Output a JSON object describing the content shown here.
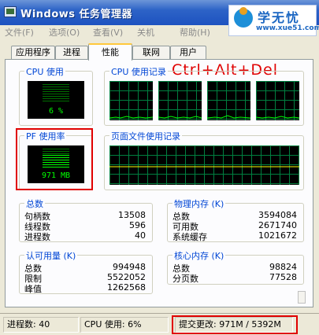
{
  "window": {
    "title": "Windows 任务管理器"
  },
  "brand": {
    "name": "学无忧",
    "url": "www.xue51.com"
  },
  "menu": {
    "items": [
      "文件(F)",
      "选项(O)",
      "查看(V)",
      "关机",
      "帮助(H)"
    ]
  },
  "tabs": [
    "应用程序",
    "进程",
    "性能",
    "联网",
    "用户"
  ],
  "active_tab": "性能",
  "overlay_hint": "Ctrl+Alt+Del",
  "cpu_usage": {
    "label": "CPU 使用",
    "value": "6 %",
    "fraction": 0.06
  },
  "cpu_history": {
    "label": "CPU 使用记录",
    "graph_count": 4
  },
  "pf_usage": {
    "label": "PF 使用率",
    "value": "971 MB"
  },
  "pf_history": {
    "label": "页面文件使用记录"
  },
  "totals": {
    "label": "总数",
    "rows": [
      {
        "label": "句柄数",
        "value": "13508"
      },
      {
        "label": "线程数",
        "value": "596"
      },
      {
        "label": "进程数",
        "value": "40"
      }
    ]
  },
  "physical_memory": {
    "label": "物理内存 (K)",
    "rows": [
      {
        "label": "总数",
        "value": "3594084"
      },
      {
        "label": "可用数",
        "value": "2671740"
      },
      {
        "label": "系统缓存",
        "value": "1021672"
      }
    ]
  },
  "commit_charge": {
    "label": "认可用量 (K)",
    "rows": [
      {
        "label": "总数",
        "value": "994948"
      },
      {
        "label": "限制",
        "value": "5522052"
      },
      {
        "label": "峰值",
        "value": "1262568"
      }
    ]
  },
  "kernel_memory": {
    "label": "核心内存 (K)",
    "rows": [
      {
        "label": "总数",
        "value": "98824"
      },
      {
        "label": "分页数",
        "value": "77528"
      }
    ]
  },
  "status": {
    "processes": "进程数: 40",
    "cpu": "CPU 使用: 6%",
    "commit": "提交更改: 971M / 5392M"
  },
  "colors": {
    "titlebar": "#2d63c7",
    "group_label": "#0046d5",
    "graph_line": "#00ff00",
    "grid": "#008040",
    "highlight": "#e00000"
  }
}
